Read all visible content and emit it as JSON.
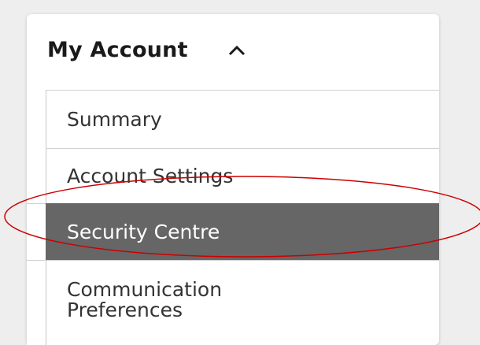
{
  "menu": {
    "title": "My Account",
    "expanded_icon": "chevron-up-icon",
    "items": [
      {
        "label": "Summary"
      },
      {
        "label": "Account Settings"
      },
      {
        "label": "Security Centre",
        "active": true
      },
      {
        "label": "Communication Preferences"
      }
    ]
  },
  "colors": {
    "active_background": "#666666",
    "annotation_ellipse": "#cc0000",
    "panel_background": "#ffffff",
    "page_background": "#eeeeee"
  }
}
